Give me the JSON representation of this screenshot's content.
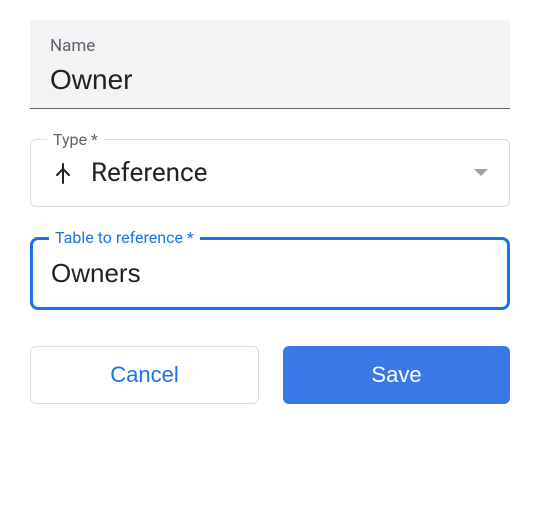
{
  "name_field": {
    "label": "Name",
    "value": "Owner"
  },
  "type_field": {
    "label": "Type *",
    "value": "Reference"
  },
  "table_ref_field": {
    "label": "Table to reference *",
    "value": "Owners"
  },
  "buttons": {
    "cancel": "Cancel",
    "save": "Save"
  }
}
